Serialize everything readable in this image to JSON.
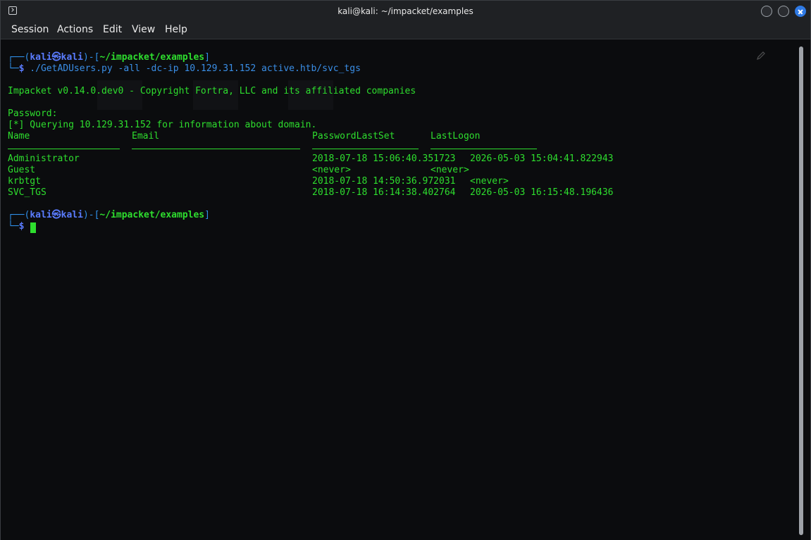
{
  "window": {
    "title": "kali@kali: ~/impacket/examples"
  },
  "menu": {
    "items": [
      "Session",
      "Actions",
      "Edit",
      "View",
      "Help"
    ]
  },
  "terminal": {
    "prompt1": {
      "box_top": "┌──(",
      "user_host": "kali㉿kali",
      "sep": ")-[",
      "path": "~/impacket/examples",
      "close": "]",
      "box_bottom": "└─",
      "dollar": "$",
      "command": " ./GetADUsers.py -all -dc-ip 10.129.31.152 active.htb/svc_tgs"
    },
    "banner": "Impacket v0.14.0.dev0 - Copyright Fortra, LLC and its affiliated companies",
    "password_prompt": "Password:",
    "querying": "[*] Querying 10.129.31.152 for information about domain.",
    "table": {
      "headers": [
        "Name",
        "Email",
        "PasswordLastSet",
        "LastLogon"
      ],
      "rows": [
        [
          "Administrator",
          "",
          "2018-07-18 15:06:40.351723",
          "2026-05-03 15:04:41.822943"
        ],
        [
          "Guest",
          "",
          "<never>",
          "<never>"
        ],
        [
          "krbtgt",
          "",
          "2018-07-18 14:50:36.972031",
          "<never>"
        ],
        [
          "SVC_TGS",
          "",
          "2018-07-18 16:14:38.402764",
          "2026-05-03 16:15:48.196436"
        ]
      ]
    },
    "prompt2": {
      "box_top": "┌──(",
      "user_host": "kali㉿kali",
      "sep": ")-[",
      "path": "~/impacket/examples",
      "close": "]",
      "box_bottom": "└─",
      "dollar": "$"
    }
  },
  "colors": {
    "terminal_bg": "#0b0c0e",
    "output_green": "#2ede2e",
    "prompt_blue": "#5a7cff",
    "command_blue": "#3a8ee6",
    "close_button": "#2f7ae5"
  }
}
